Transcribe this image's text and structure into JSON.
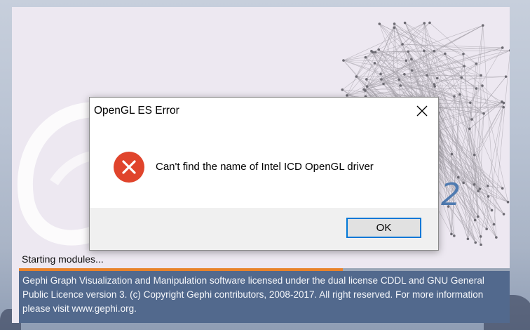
{
  "splash": {
    "version_suffix": ".2",
    "status": "Starting modules...",
    "progress_fraction": 0.66,
    "license": "Gephi Graph Visualization and Manipulation software licensed under the dual license CDDL and GNU General Public Licence version 3. (c) Copyright Gephi contributors, 2008-2017. All right reserved. For more information  please visit www.gephi.org."
  },
  "dialog": {
    "title": "OpenGL ES Error",
    "message": "Can't find the name of Intel ICD OpenGL driver",
    "ok_label": "OK"
  },
  "icons": {
    "close": "close-icon",
    "error": "error-icon"
  },
  "colors": {
    "error_red": "#e0442c",
    "progress_orange": "#e8822b",
    "license_bg": "#52698d",
    "focus_blue": "#0078d7"
  }
}
